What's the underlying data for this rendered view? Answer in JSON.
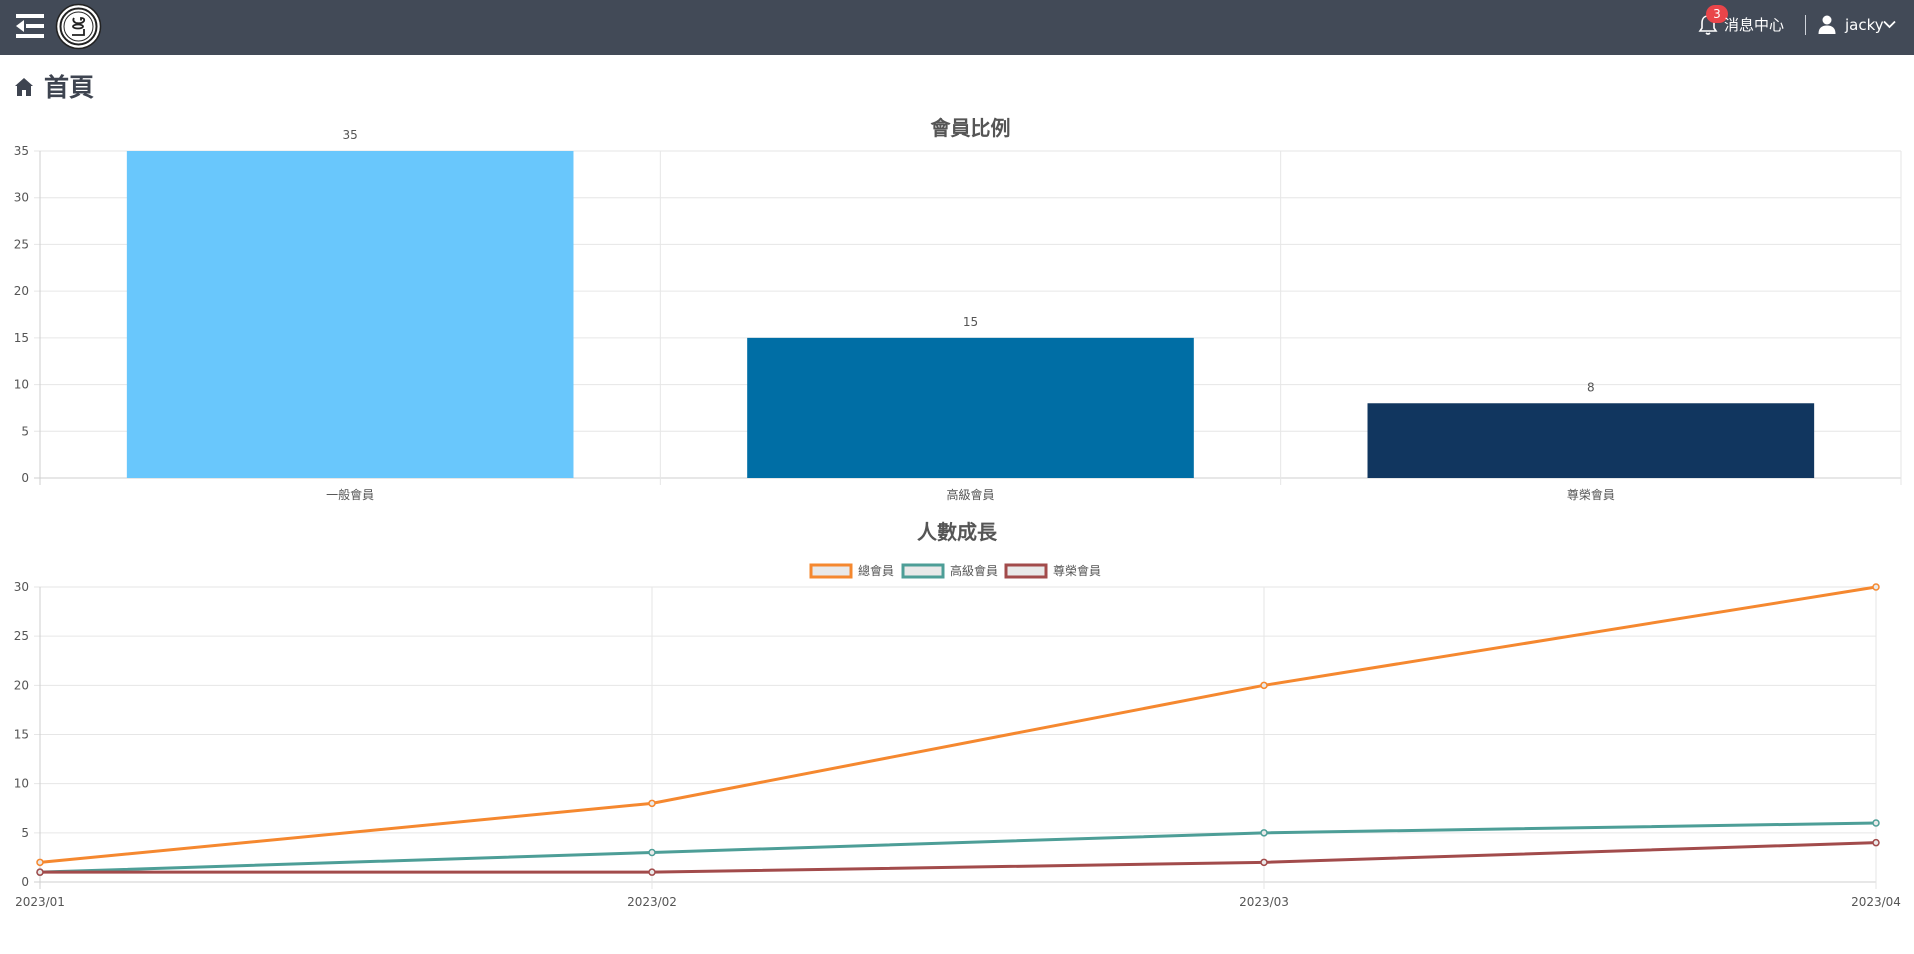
{
  "topbar": {
    "notification_count": "3",
    "message_center_label": "消息中心",
    "user_name": "jacky"
  },
  "page": {
    "title": "首頁"
  },
  "colors": {
    "topbar_bg": "#424a57",
    "badge": "#e9454a"
  },
  "chart_data": [
    {
      "type": "bar",
      "title": "會員比例",
      "categories": [
        "一般會員",
        "高級會員",
        "尊榮會員"
      ],
      "values": [
        35,
        15,
        8
      ],
      "bar_colors": [
        "#69c7fc",
        "#006ea5",
        "#11365f"
      ],
      "data_labels": true,
      "xlabel": "",
      "ylabel": "",
      "ylim": [
        0,
        35
      ],
      "yticks": [
        0,
        5,
        10,
        15,
        20,
        25,
        30,
        35
      ],
      "grid": true,
      "legend": "none"
    },
    {
      "type": "line",
      "title": "人數成長",
      "x": [
        "2023/01",
        "2023/02",
        "2023/03",
        "2023/04"
      ],
      "series": [
        {
          "name": "總會員",
          "values": [
            2,
            8,
            20,
            30
          ],
          "color": "#f5882f"
        },
        {
          "name": "高級會員",
          "values": [
            1,
            3,
            5,
            6
          ],
          "color": "#4d9e97"
        },
        {
          "name": "尊榮會員",
          "values": [
            1,
            1,
            2,
            4
          ],
          "color": "#a24b4b"
        }
      ],
      "xlabel": "",
      "ylabel": "",
      "ylim": [
        0,
        30
      ],
      "yticks": [
        0,
        5,
        10,
        15,
        20,
        25,
        30
      ],
      "grid": true,
      "legend": "top-center"
    }
  ]
}
